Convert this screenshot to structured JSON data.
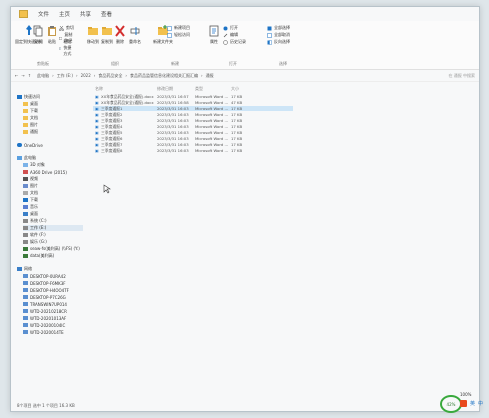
{
  "title_tabs": [
    "文件",
    "主页",
    "共享",
    "查看"
  ],
  "ribbon": {
    "groups": [
      {
        "name": "剪贴板",
        "buttons": [
          "固定到快速访问",
          "复制",
          "粘贴",
          "剪切",
          "复制路径",
          "粘贴快捷方式"
        ]
      },
      {
        "name": "组织",
        "buttons": [
          "移动到",
          "复制到",
          "删除",
          "重命名"
        ]
      },
      {
        "name": "新建",
        "buttons": [
          "新建文件夹",
          "新建项目",
          "轻松访问"
        ]
      },
      {
        "name": "打开",
        "buttons": [
          "属性",
          "打开",
          "编辑",
          "历史记录"
        ]
      },
      {
        "name": "选择",
        "buttons": [
          "全部选择",
          "全部取消",
          "反向选择"
        ]
      }
    ]
  },
  "address": {
    "path": [
      "此电脑",
      "工作 (E:)",
      "2022",
      "食品药品安全",
      "食品药品监管信息化建设相关汇报汇编",
      "通报"
    ],
    "search_placeholder": "在 通报 中搜索"
  },
  "nav": {
    "items": [
      "快速访问",
      "桌面",
      "下载",
      "文档",
      "图片",
      "通报",
      "OneDrive",
      "此电脑",
      "3D 对象",
      "A360 Drive (2015)",
      "视频",
      "图片",
      "文档",
      "下载",
      "音乐",
      "桌面",
      "系统 (C:)",
      "工作 (E:)",
      "软件 (F:)",
      "娱乐 (G:)",
      "seaw-fs(美利高) (\\\\FS) (Y:)",
      "data(美利高)",
      "网络",
      "DESKTOP-0URA42",
      "DESKTOP-F6MK3F",
      "DESKTOP-H4OO4TF",
      "DESKTOP-P7C26G",
      "TRANSWIN7UP014",
      "WTD-20210218CR",
      "WTD-20201013AF",
      "WTD-20200104IC",
      "WTD-2020014TE"
    ]
  },
  "files": {
    "columns": [
      "名称",
      "修改日期",
      "类型",
      "大小"
    ],
    "rows": [
      {
        "name": "XX年食品药品安全(通报).docx",
        "date": "2023/3/31 16:57",
        "type": "Microsoft Word ...",
        "size": "17 KB"
      },
      {
        "name": "XX年食品药品安全(通报).docx",
        "date": "2023/3/31 16:58",
        "type": "Microsoft Word ...",
        "size": "47 KB"
      },
      {
        "name": "三季度通报1",
        "date": "2023/3/31 16:03",
        "type": "Microsoft Word ...",
        "size": "17 KB"
      },
      {
        "name": "三季度通报2",
        "date": "2023/3/31 16:03",
        "type": "Microsoft Word ...",
        "size": "17 KB"
      },
      {
        "name": "三季度通报3",
        "date": "2023/3/31 16:03",
        "type": "Microsoft Word ...",
        "size": "17 KB"
      },
      {
        "name": "三季度通报4",
        "date": "2023/3/31 16:03",
        "type": "Microsoft Word ...",
        "size": "17 KB"
      },
      {
        "name": "三季度通报5",
        "date": "2023/3/31 16:03",
        "type": "Microsoft Word ...",
        "size": "17 KB"
      },
      {
        "name": "三季度通报6",
        "date": "2023/3/31 16:03",
        "type": "Microsoft Word ...",
        "size": "17 KB"
      },
      {
        "name": "三季度通报7",
        "date": "2023/3/31 16:03",
        "type": "Microsoft Word ...",
        "size": "17 KB"
      },
      {
        "name": "三季度通报8",
        "date": "2023/3/31 16:03",
        "type": "Microsoft Word ...",
        "size": "17 KB"
      }
    ],
    "selected_index": 2
  },
  "status": {
    "text": "8个项目  选中 1 个项目  16.3 KB"
  },
  "tray": {
    "zoom": "42%",
    "zoom_label": "100%",
    "items": [
      "英",
      "中"
    ]
  },
  "colors": {
    "accent": "#0078d7",
    "selection": "#cde5f7",
    "zoom_ring": "#39a93d"
  }
}
